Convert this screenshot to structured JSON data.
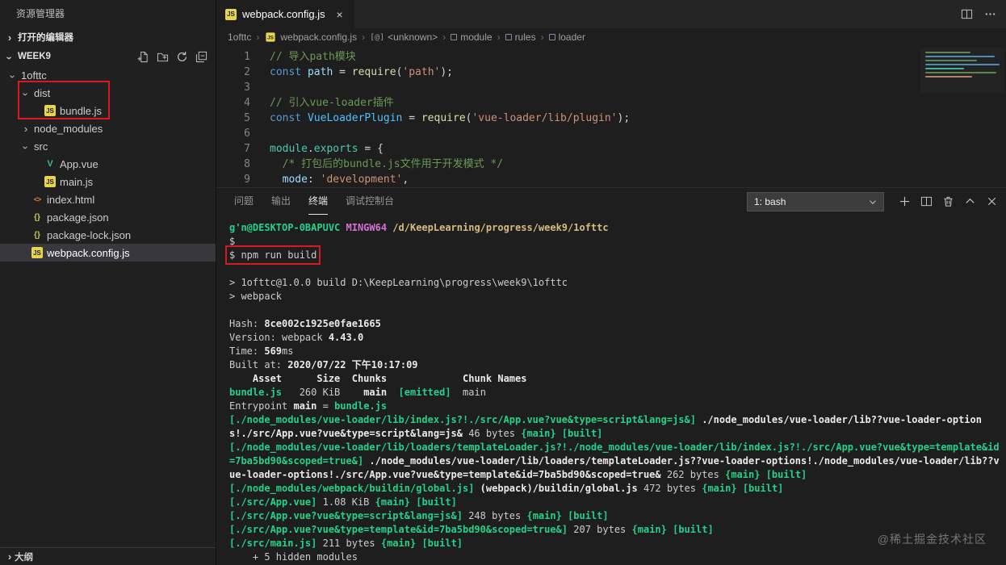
{
  "colors": {
    "annotation_red": "#d71920",
    "selection_bg": "#37373d",
    "terminal_green": "#23d18b",
    "terminal_magenta": "#d670d6",
    "terminal_yellow": "#d7ba7d"
  },
  "icons": {
    "js": {
      "glyph": "JS",
      "color": "#e8d44d"
    },
    "vue": {
      "glyph": "V",
      "color": "#41b883"
    },
    "html": {
      "glyph": "<>",
      "color": "#e07a3f"
    },
    "json": {
      "glyph": "{}",
      "color": "#cbcb41"
    },
    "chevron": {
      "glyph": "›"
    },
    "close": {
      "glyph": "×"
    },
    "symbol_unknown": {
      "glyph": "[@]"
    }
  },
  "sidebar": {
    "title": "资源管理器",
    "sections": {
      "open_editors": "打开的编辑器",
      "workspace": "WEEK9",
      "outline": "大纲"
    },
    "tree": [
      {
        "id": "1ofttc",
        "label": "1ofttc",
        "kind": "folder",
        "expanded": true,
        "depth": 0
      },
      {
        "id": "dist",
        "label": "dist",
        "kind": "folder",
        "expanded": true,
        "depth": 1
      },
      {
        "id": "bundle-js",
        "label": "bundle.js",
        "kind": "file",
        "icon": "js",
        "depth": 2
      },
      {
        "id": "node-modules",
        "label": "node_modules",
        "kind": "folder",
        "expanded": false,
        "depth": 1
      },
      {
        "id": "src",
        "label": "src",
        "kind": "folder",
        "expanded": true,
        "depth": 1
      },
      {
        "id": "app-vue",
        "label": "App.vue",
        "kind": "file",
        "icon": "vue",
        "depth": 2
      },
      {
        "id": "main-js",
        "label": "main.js",
        "kind": "file",
        "icon": "js",
        "depth": 2
      },
      {
        "id": "index-html",
        "label": "index.html",
        "kind": "file",
        "icon": "html",
        "depth": 1
      },
      {
        "id": "package-json",
        "label": "package.json",
        "kind": "file",
        "icon": "json",
        "depth": 1
      },
      {
        "id": "package-lock-json",
        "label": "package-lock.json",
        "kind": "file",
        "icon": "json",
        "depth": 1
      },
      {
        "id": "webpack-config-js",
        "label": "webpack.config.js",
        "kind": "file",
        "icon": "js",
        "depth": 1,
        "selected": true
      }
    ]
  },
  "editor": {
    "tab_label": "webpack.config.js",
    "breadcrumb": [
      {
        "label": "1ofttc"
      },
      {
        "label": "webpack.config.js",
        "icon": "js"
      },
      {
        "label": "<unknown>",
        "icon": "at"
      },
      {
        "label": "module",
        "icon": "sym"
      },
      {
        "label": "rules",
        "icon": "sym"
      },
      {
        "label": "loader",
        "icon": "sym"
      }
    ],
    "code_lines": [
      {
        "n": 1,
        "seg": [
          {
            "t": "// 导入path模块",
            "c": "comment"
          }
        ]
      },
      {
        "n": 2,
        "seg": [
          {
            "t": "const ",
            "c": "kw"
          },
          {
            "t": "path",
            "c": "var"
          },
          {
            "t": " = ",
            "c": "pun"
          },
          {
            "t": "require",
            "c": "fn"
          },
          {
            "t": "(",
            "c": "pun"
          },
          {
            "t": "'path'",
            "c": "str"
          },
          {
            "t": ");",
            "c": "pun"
          }
        ]
      },
      {
        "n": 3,
        "seg": []
      },
      {
        "n": 4,
        "seg": [
          {
            "t": "// 引入vue-loader插件",
            "c": "comment"
          }
        ]
      },
      {
        "n": 5,
        "seg": [
          {
            "t": "const ",
            "c": "kw"
          },
          {
            "t": "VueLoaderPlugin",
            "c": "cls"
          },
          {
            "t": " = ",
            "c": "pun"
          },
          {
            "t": "require",
            "c": "fn"
          },
          {
            "t": "(",
            "c": "pun"
          },
          {
            "t": "'vue-loader/lib/plugin'",
            "c": "str"
          },
          {
            "t": ");",
            "c": "pun"
          }
        ]
      },
      {
        "n": 6,
        "seg": []
      },
      {
        "n": 7,
        "seg": [
          {
            "t": "module",
            "c": "mod"
          },
          {
            "t": ".",
            "c": "pun"
          },
          {
            "t": "exports",
            "c": "mod"
          },
          {
            "t": " = {",
            "c": "pun"
          }
        ]
      },
      {
        "n": 8,
        "seg": [
          {
            "t": "  /* 打包后的bundle.js文件用于开发模式 */",
            "c": "comment"
          }
        ]
      },
      {
        "n": 9,
        "seg": [
          {
            "t": "  mode",
            "c": "var"
          },
          {
            "t": ": ",
            "c": "pun"
          },
          {
            "t": "'development'",
            "c": "str"
          },
          {
            "t": ",",
            "c": "pun"
          }
        ]
      }
    ]
  },
  "terminal": {
    "tabs": [
      {
        "key": "problems",
        "label": "问题"
      },
      {
        "key": "output",
        "label": "输出"
      },
      {
        "key": "terminal",
        "label": "终端",
        "active": true
      },
      {
        "key": "debug-console",
        "label": "调试控制台"
      }
    ],
    "shell_selector": "1: bash",
    "lines": [
      {
        "seg": [
          {
            "t": "g'n@DESKTOP-0BAPUVC ",
            "c": "green"
          },
          {
            "t": "MINGW64 ",
            "c": "magenta"
          },
          {
            "t": "/d/KeepLearning/progress/week9/1ofttc",
            "c": "yellow"
          }
        ]
      },
      {
        "seg": [
          {
            "t": "$",
            "c": "fg"
          }
        ]
      },
      {
        "seg": [
          {
            "t": "$ npm run build",
            "c": "fg"
          }
        ],
        "boxed": true
      },
      {
        "seg": []
      },
      {
        "seg": [
          {
            "t": "> 1ofttc@1.0.0 build D:\\KeepLearning\\progress\\week9\\1ofttc",
            "c": "fg"
          }
        ]
      },
      {
        "seg": [
          {
            "t": "> webpack",
            "c": "fg"
          }
        ]
      },
      {
        "seg": []
      },
      {
        "seg": [
          {
            "t": "Hash: ",
            "c": "fg"
          },
          {
            "t": "8ce002c1925e0fae1665",
            "c": "bold"
          }
        ]
      },
      {
        "seg": [
          {
            "t": "Version: webpack ",
            "c": "fg"
          },
          {
            "t": "4.43.0",
            "c": "bold"
          }
        ]
      },
      {
        "seg": [
          {
            "t": "Time: ",
            "c": "fg"
          },
          {
            "t": "569",
            "c": "bold"
          },
          {
            "t": "ms",
            "c": "fg"
          }
        ]
      },
      {
        "seg": [
          {
            "t": "Built at: ",
            "c": "fg"
          },
          {
            "t": "2020/07/22 下午10:17:09",
            "c": "bold"
          }
        ]
      },
      {
        "seg": [
          {
            "t": "    Asset      Size  Chunks             Chunk Names",
            "c": "bold"
          }
        ]
      },
      {
        "seg": [
          {
            "t": "bundle.js",
            "c": "green"
          },
          {
            "t": "   260 KiB    ",
            "c": "fg"
          },
          {
            "t": "main",
            "c": "bold"
          },
          {
            "t": "  ",
            "c": "fg"
          },
          {
            "t": "[emitted]",
            "c": "green"
          },
          {
            "t": "  main",
            "c": "fg"
          }
        ]
      },
      {
        "seg": [
          {
            "t": "Entrypoint ",
            "c": "fg"
          },
          {
            "t": "main",
            "c": "bold"
          },
          {
            "t": " = ",
            "c": "fg"
          },
          {
            "t": "bundle.js",
            "c": "green"
          }
        ]
      },
      {
        "seg": [
          {
            "t": "[./node_modules/vue-loader/lib/index.js?!./src/App.vue?vue&type=script&lang=js&]",
            "c": "green"
          },
          {
            "t": " ",
            "c": "fg"
          },
          {
            "t": "./node_modules/vue-loader/lib??vue-loader-options!./src/App.vue?vue&type=script&lang=js&",
            "c": "bold"
          },
          {
            "t": " 46 bytes ",
            "c": "fg"
          },
          {
            "t": "{main}",
            "c": "green"
          },
          {
            "t": " ",
            "c": "fg"
          },
          {
            "t": "[built]",
            "c": "green"
          }
        ]
      },
      {
        "seg": [
          {
            "t": "[./node_modules/vue-loader/lib/loaders/templateLoader.js?!./node_modules/vue-loader/lib/index.js?!./src/App.vue?vue&type=template&id=7ba5bd90&scoped=true&]",
            "c": "green"
          },
          {
            "t": " ",
            "c": "fg"
          },
          {
            "t": "./node_modules/vue-loader/lib/loaders/templateLoader.js??vue-loader-options!./node_modules/vue-loader/lib??vue-loader-options!./src/App.vue?vue&type=template&id=7ba5bd90&scoped=true&",
            "c": "bold"
          },
          {
            "t": " 262 bytes ",
            "c": "fg"
          },
          {
            "t": "{main}",
            "c": "green"
          },
          {
            "t": " ",
            "c": "fg"
          },
          {
            "t": "[built]",
            "c": "green"
          }
        ]
      },
      {
        "seg": [
          {
            "t": "[./node_modules/webpack/buildin/global.js]",
            "c": "green"
          },
          {
            "t": " ",
            "c": "fg"
          },
          {
            "t": "(webpack)/buildin/global.js",
            "c": "bold"
          },
          {
            "t": " 472 bytes ",
            "c": "fg"
          },
          {
            "t": "{main}",
            "c": "green"
          },
          {
            "t": " ",
            "c": "fg"
          },
          {
            "t": "[built]",
            "c": "green"
          }
        ]
      },
      {
        "seg": [
          {
            "t": "[./src/App.vue]",
            "c": "green"
          },
          {
            "t": " 1.08 KiB ",
            "c": "fg"
          },
          {
            "t": "{main}",
            "c": "green"
          },
          {
            "t": " ",
            "c": "fg"
          },
          {
            "t": "[built]",
            "c": "green"
          }
        ]
      },
      {
        "seg": [
          {
            "t": "[./src/App.vue?vue&type=script&lang=js&]",
            "c": "green"
          },
          {
            "t": " 248 bytes ",
            "c": "fg"
          },
          {
            "t": "{main}",
            "c": "green"
          },
          {
            "t": " ",
            "c": "fg"
          },
          {
            "t": "[built]",
            "c": "green"
          }
        ]
      },
      {
        "seg": [
          {
            "t": "[./src/App.vue?vue&type=template&id=7ba5bd90&scoped=true&]",
            "c": "green"
          },
          {
            "t": " 207 bytes ",
            "c": "fg"
          },
          {
            "t": "{main}",
            "c": "green"
          },
          {
            "t": " ",
            "c": "fg"
          },
          {
            "t": "[built]",
            "c": "green"
          }
        ]
      },
      {
        "seg": [
          {
            "t": "[./src/main.js]",
            "c": "green"
          },
          {
            "t": " 211 bytes ",
            "c": "fg"
          },
          {
            "t": "{main}",
            "c": "green"
          },
          {
            "t": " ",
            "c": "fg"
          },
          {
            "t": "[built]",
            "c": "green"
          }
        ]
      },
      {
        "seg": [
          {
            "t": "    + 5 hidden modules",
            "c": "fg"
          }
        ]
      }
    ]
  },
  "watermark": "@稀土掘金技术社区"
}
